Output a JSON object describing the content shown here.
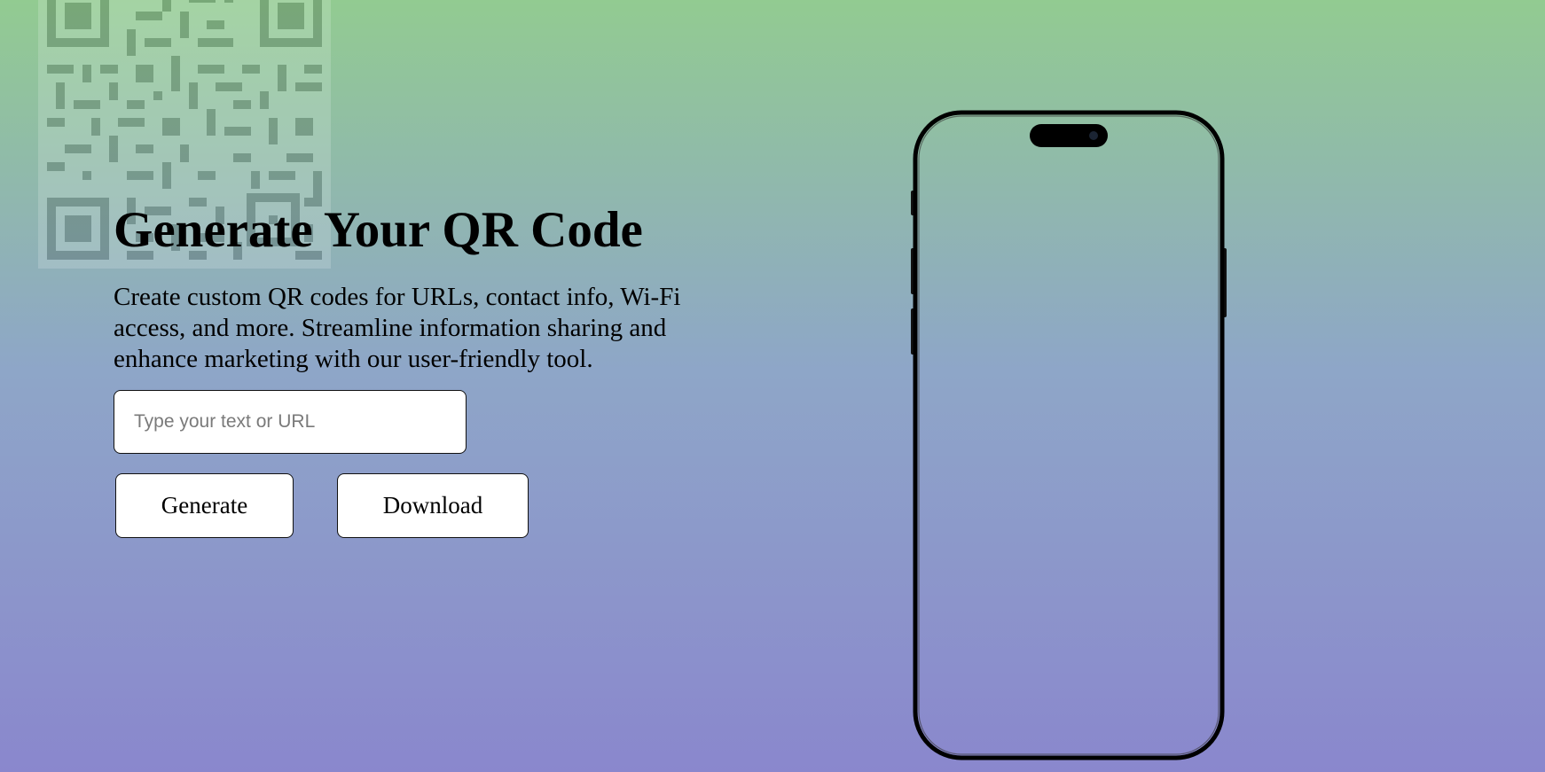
{
  "hero": {
    "title": "Generate Your QR Code",
    "description": "Create custom QR codes for URLs, contact info, Wi-Fi access, and more. Streamline information sharing and enhance marketing with our user-friendly tool."
  },
  "form": {
    "input_placeholder": "Type your text or URL",
    "input_value": "",
    "generate_label": "Generate",
    "download_label": "Download"
  },
  "preview": {
    "device": "phone-outline"
  },
  "decoration": {
    "icon": "qr-code-icon"
  }
}
